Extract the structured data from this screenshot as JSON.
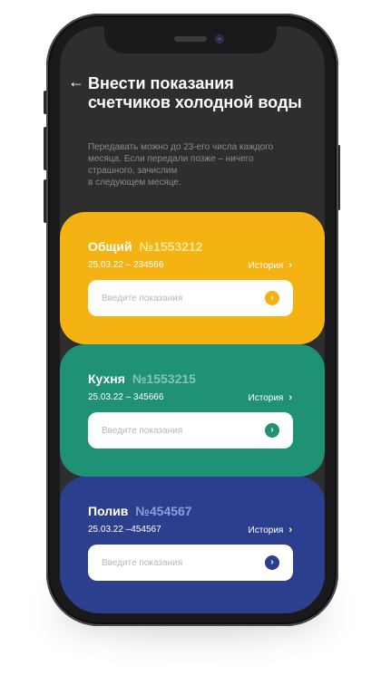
{
  "header": {
    "title": "Внести показания счетчиков холодной воды",
    "subtitle": "Передавать можно до 23-его числа каждого месяца. Если передали позже – ничего страшного, зачислим\nв следующем месяце."
  },
  "meters": [
    {
      "name": "Общий",
      "number": "№1553212",
      "last_reading": "25.03.22 – 234566",
      "history_label": "История",
      "input_placeholder": "Введите показания",
      "input_value": "",
      "color": "#f4b213"
    },
    {
      "name": "Кухня",
      "number": "№1553215",
      "last_reading": "25.03.22 – 345666",
      "history_label": "История",
      "input_placeholder": "Введите показания",
      "input_value": "",
      "color": "#1f9276"
    },
    {
      "name": "Полив",
      "number": "№454567",
      "last_reading": "25.03.22 –454567",
      "history_label": "История",
      "input_placeholder": "Введите показания",
      "input_value": "",
      "color": "#2c3f8e"
    }
  ],
  "icons": {
    "back": "←",
    "chevron": "›",
    "submit": "›"
  },
  "theme": {
    "screen_bg": "#2e2e2e",
    "text_primary": "#ffffff",
    "text_muted": "#8b8b8b"
  }
}
